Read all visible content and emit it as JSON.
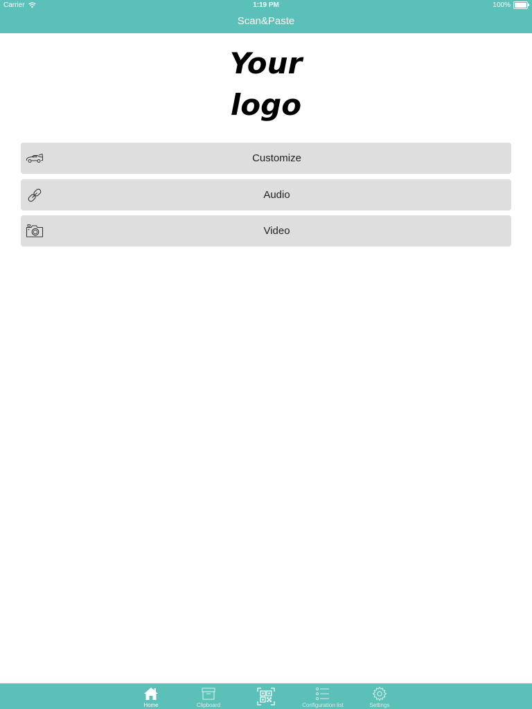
{
  "status_bar": {
    "carrier": "Carrier",
    "time": "1:19 PM",
    "battery": "100%",
    "battery_level": 1.0
  },
  "nav": {
    "title": "Scan&Paste"
  },
  "logo": {
    "line1": "Your",
    "line2": "logo"
  },
  "menu": {
    "items": [
      {
        "label": "Customize",
        "icon": "car-icon"
      },
      {
        "label": "Audio",
        "icon": "link-icon"
      },
      {
        "label": "Video",
        "icon": "camera-icon"
      }
    ]
  },
  "tabbar": {
    "items": [
      {
        "label": "Home",
        "icon": "home-icon",
        "active": true
      },
      {
        "label": "Clipboard",
        "icon": "archive-box-icon",
        "active": false
      },
      {
        "label": "",
        "icon": "qr-code-icon",
        "active": false
      },
      {
        "label": "Configuration list",
        "icon": "list-icon",
        "active": false
      },
      {
        "label": "Settings",
        "icon": "gear-icon",
        "active": false
      }
    ]
  },
  "colors": {
    "accent": "#5bc0b7",
    "button_bg": "#dedede",
    "text": "#222222",
    "tab_inactive": "#d4f0ed"
  }
}
